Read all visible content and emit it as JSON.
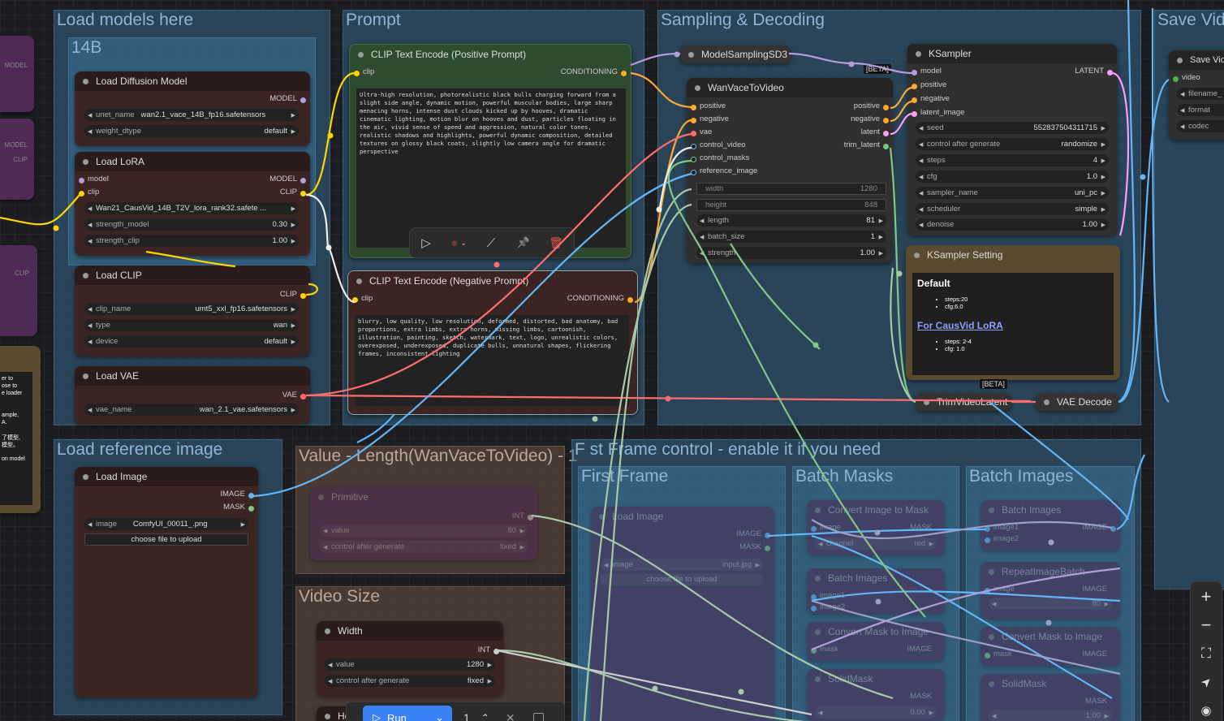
{
  "groups": {
    "load_models": "Load models here",
    "sub_14b": "14B",
    "prompt": "Prompt",
    "sampling": "Sampling & Decoding",
    "save_video": "Save Vide",
    "load_reference": "Load reference image",
    "values_length": "Value - Length(WanVaceToVideo) - 1",
    "video_size": "Video Size",
    "first_frame_control": "F st Frame control - enable it if you need",
    "first_frame": "First Frame",
    "batch_masks": "Batch Masks",
    "batch_images": "Batch Images"
  },
  "left_clip": {
    "model1": "MODEL",
    "model2": "MODEL",
    "clip1": "CLIP",
    "clip2": "CLIP",
    "note_lines": [
      "er to",
      "ose to",
      "e loader",
      "ample,",
      "A.",
      "了模型,",
      "模型。",
      "on model"
    ]
  },
  "load_diffusion": {
    "title": "Load Diffusion Model",
    "out": "MODEL",
    "unet_label": "unet_name",
    "unet_value": "wan2.1_vace_14B_fp16.safetensors",
    "dtype_label": "weight_dtype",
    "dtype_value": "default"
  },
  "load_lora": {
    "title": "Load LoRA",
    "in_model": "model",
    "in_clip": "clip",
    "out_model": "MODEL",
    "out_clip": "CLIP",
    "lora_value": "Wan21_CausVid_14B_T2V_lora_rank32.safete ...",
    "sm_label": "strength_model",
    "sm_value": "0.30",
    "sc_label": "strength_clip",
    "sc_value": "1.00"
  },
  "load_clip": {
    "title": "Load CLIP",
    "out": "CLIP",
    "name_label": "clip_name",
    "name_value": "umt5_xxl_fp16.safetensors",
    "type_label": "type",
    "type_value": "wan",
    "device_label": "device",
    "device_value": "default"
  },
  "load_vae": {
    "title": "Load VAE",
    "out": "VAE",
    "name_label": "vae_name",
    "name_value": "wan_2.1_vae.safetensors"
  },
  "clip_positive": {
    "title": "CLIP Text Encode (Positive Prompt)",
    "in": "clip",
    "out": "CONDITIONING",
    "text": "Ultra-high resolution, photorealistic black bulls charging forward from a slight side angle, dynamic motion, powerful muscular bodies, large sharp menacing horns, intense dust clouds kicked up by hooves, dramatic cinematic lighting, motion blur on hooves and dust, particles floating in the air, vivid sense of speed and aggression, natural color tones, realistic shadows and highlights, powerful dynamic composition, detailed textures on glossy black coats, slightly low camera angle for dramatic perspective"
  },
  "clip_negative": {
    "title": "CLIP Text Encode (Negative Prompt)",
    "in": "clip",
    "out": "CONDITIONING",
    "text": "blurry, low quality, low resolution, deformed, distorted, bad anatomy, bad proportions, extra limbs, extra horns, missing limbs, cartoonish, illustration, painting, sketch, watermark, text, logo, unrealistic colors, overexposed, underexposed, duplicate bulls, unnatural shapes, flickering frames, inconsistent lighting"
  },
  "model_sampling": {
    "title": "ModelSamplingSD3",
    "beta": "[BETA]"
  },
  "wan_vace": {
    "title": "WanVaceToVideo",
    "inputs": [
      "positive",
      "negative",
      "vae",
      "control_video",
      "control_masks",
      "reference_image"
    ],
    "outputs": [
      "positive",
      "negative",
      "latent",
      "trim_latent"
    ],
    "width_label": "width",
    "width_value": "1280",
    "height_label": "height",
    "height_value": "848",
    "length_label": "length",
    "length_value": "81",
    "batch_label": "batch_size",
    "batch_value": "1",
    "strength_label": "strength",
    "strength_value": "1.00"
  },
  "ksampler": {
    "title": "KSampler",
    "inputs": [
      "model",
      "positive",
      "negative",
      "latent_image"
    ],
    "out": "LATENT",
    "seed_label": "seed",
    "seed_value": "552837504311715",
    "cag_label": "control after generate",
    "cag_value": "randomize",
    "steps_label": "steps",
    "steps_value": "4",
    "cfg_label": "cfg",
    "cfg_value": "1.0",
    "sampler_label": "sampler_name",
    "sampler_value": "uni_pc",
    "scheduler_label": "scheduler",
    "scheduler_value": "simple",
    "denoise_label": "denoise",
    "denoise_value": "1.00"
  },
  "ksampler_setting": {
    "title": "KSampler Setting",
    "default_heading": "Default",
    "default_items": [
      "steps:20",
      "cfg:6.0"
    ],
    "link": "For CausVid LoRA",
    "lora_items": [
      "steps: 2-4",
      "cfg: 1.0"
    ]
  },
  "trim_latent": {
    "title": "TrimVideoLatent",
    "beta": "[BETA]"
  },
  "vae_decode": {
    "title": "VAE Decode"
  },
  "save_video": {
    "title": "Save Vid",
    "in": "video",
    "w1": "filename_",
    "w2": "format",
    "w3": "codec"
  },
  "node_toolbar": {
    "run": "▷",
    "color": "●",
    "pin": "📌",
    "delete": "🗑"
  },
  "load_image": {
    "title": "Load Image",
    "out_image": "IMAGE",
    "out_mask": "MASK",
    "image_label": "image",
    "image_value": "ComfyUI_00011_.png",
    "upload": "choose file to upload"
  },
  "primitive": {
    "title": "Primitive",
    "out": "INT",
    "value_label": "value",
    "value_value": "80",
    "cag_label": "control after generate",
    "cag_value": "fixed"
  },
  "width_node": {
    "title": "Width",
    "out": "INT",
    "value_label": "value",
    "value_value": "1280",
    "cag_label": "control after generate",
    "cag_value": "fixed"
  },
  "height_node": {
    "title": "He"
  },
  "ff_load_image": {
    "title": "Load Image",
    "out_image": "IMAGE",
    "out_mask": "MASK",
    "image_label": "image",
    "image_value": "input.jpg",
    "upload": "choose file to upload"
  },
  "convert_image_mask": {
    "title": "Convert Image to Mask",
    "in": "image",
    "ch_label": "channel",
    "ch_value": "red",
    "out": "MASK"
  },
  "batch_images_mask": {
    "title": "Batch Images",
    "in1": "image1",
    "in2": "image2"
  },
  "convert_mask_image": {
    "title": "Convert Mask to Image",
    "in": "mask",
    "out": "IMAGE"
  },
  "solid_mask": {
    "title": "SolidMask",
    "out": "MASK",
    "value": "0.00"
  },
  "bi_batch_images": {
    "title": "Batch Images",
    "in1": "image1",
    "in2": "image2",
    "out": "IMAGE"
  },
  "repeat_image": {
    "title": "RepeatImageBatch",
    "in": "image",
    "out": "IMAGE",
    "amount": "80"
  },
  "bi_convert": {
    "title": "Convert Mask to Image",
    "in": "mask",
    "out": "IMAGE"
  },
  "bi_solid": {
    "title": "SolidMask",
    "out": "MASK",
    "value": "1.00"
  },
  "bottom_bar": {
    "run": "Run",
    "count": "1"
  },
  "side_controls": {
    "zoom_in": "+",
    "zoom_out": "−",
    "fit": "⛶",
    "locate": "➤",
    "eye": "◉"
  },
  "colors": {
    "clip_wire": "#ffd500",
    "model_wire": "#b39ddb",
    "vae_wire": "#ff6e6e",
    "cond_wire": "#ffa931",
    "image_wire": "#64b5f6",
    "latent_wire": "#ff9cf9",
    "int_wire": "#a8c8a8",
    "mask_wire": "#81c784"
  }
}
